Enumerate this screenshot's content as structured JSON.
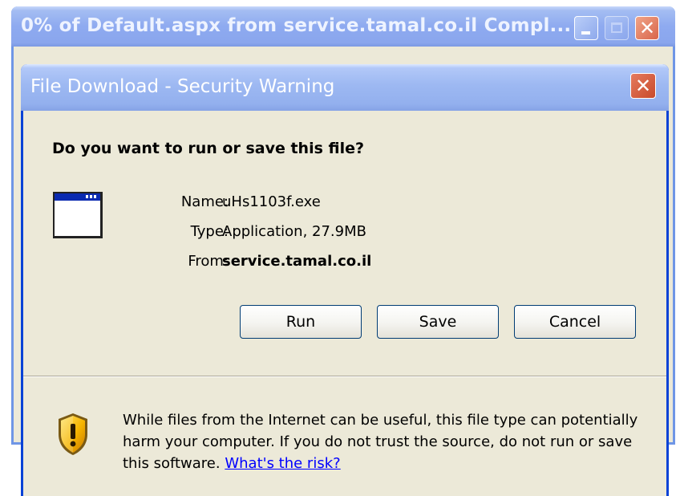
{
  "back_window": {
    "title": "0% of Default.aspx from service.tamal.co.il Compl...",
    "colors": {
      "titlebar": "#8eaaf0",
      "frame": "#6f96e6"
    }
  },
  "dialog": {
    "title": "File Download - Security Warning",
    "question": "Do you want to run or save this file?",
    "fields": {
      "name_label": "Name:",
      "name_value": "uHs1103f.exe",
      "type_label": "Type:",
      "type_value": "Application, 27.9MB",
      "from_label": "From:",
      "from_value": "service.tamal.co.il"
    },
    "buttons": {
      "run": "Run",
      "save": "Save",
      "cancel": "Cancel"
    },
    "warning": {
      "text": "While files from the Internet can be useful, this file type can potentially harm your computer. If you do not trust the source, do not run or save this software.",
      "link": "What's the risk?"
    },
    "icons": {
      "file": "application-window-icon",
      "warning": "security-shield-icon",
      "close": "close-icon"
    },
    "colors": {
      "background": "#ece9d8",
      "frame": "#0842d6",
      "link": "#0000ff",
      "button_border": "#003c74"
    }
  }
}
